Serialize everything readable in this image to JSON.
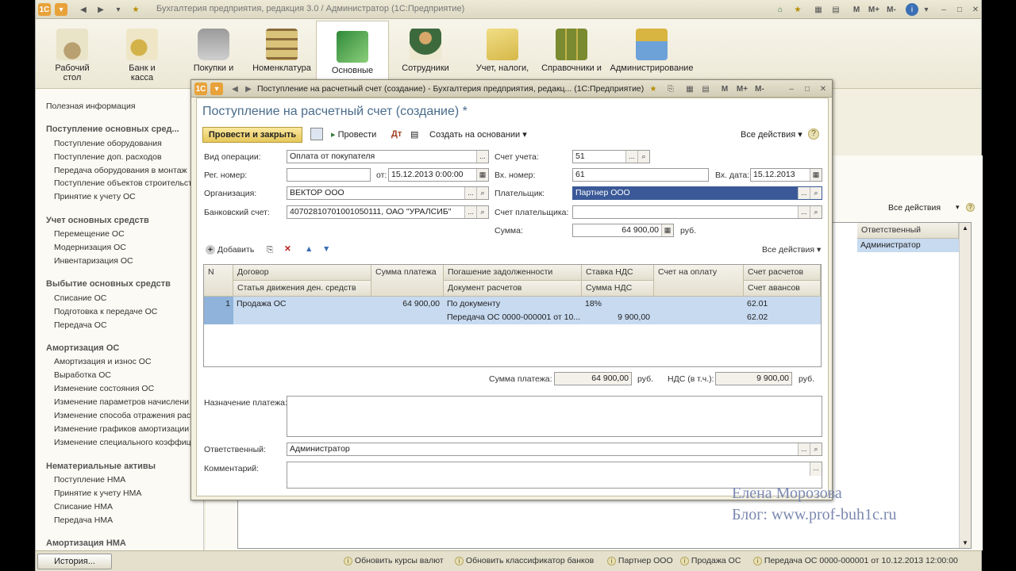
{
  "app": {
    "title": "Бухгалтерия предприятия, редакция 3.0 / Администратор  (1С:Предприятие)"
  },
  "sections": [
    {
      "label1": "Рабочий",
      "label2": "стол"
    },
    {
      "label1": "Банк и",
      "label2": "касса"
    },
    {
      "label1": "Покупки и",
      "label2": ""
    },
    {
      "label1": "Номенклатура",
      "label2": ""
    },
    {
      "label1": "Основные",
      "label2": ""
    },
    {
      "label1": "Сотрудники",
      "label2": ""
    },
    {
      "label1": "Учет, налоги,",
      "label2": ""
    },
    {
      "label1": "Справочники и",
      "label2": ""
    },
    {
      "label1": "Администрирование",
      "label2": ""
    }
  ],
  "left_panel": {
    "useful": "Полезная информация",
    "groups": [
      {
        "title": "Поступление основных сред...",
        "items": [
          "Поступление оборудования",
          "Поступление доп. расходов",
          "Передача оборудования в монтаж",
          "Поступление объектов строительст",
          "Принятие к учету ОС"
        ]
      },
      {
        "title": "Учет основных средств",
        "items": [
          "Перемещение ОС",
          "Модернизация ОС",
          "Инвентаризация ОС"
        ]
      },
      {
        "title": "Выбытие основных средств",
        "items": [
          "Списание ОС",
          "Подготовка к передаче ОС",
          "Передача ОС"
        ]
      },
      {
        "title": "Амортизация ОС",
        "items": [
          "Амортизация и износ ОС",
          "Выработка ОС",
          "Изменение состояния ОС",
          "Изменение параметров начислени",
          "Изменение способа отражения рас",
          "Изменение графиков амортизации",
          "Изменение специального коэффиц"
        ]
      },
      {
        "title": "Нематериальные активы",
        "items": [
          "Поступление НМА",
          "Принятие к учету НМА",
          "Списание НМА",
          "Передача НМА"
        ]
      },
      {
        "title": "Амортизация НМА",
        "items": []
      }
    ]
  },
  "background_list": {
    "all_actions": "Все действия",
    "col_responsible": "Ответственный",
    "row_responsible": "Администратор"
  },
  "modal": {
    "window_title": "Поступление на расчетный счет (создание) - Бухгалтерия предприятия, редакц... (1С:Предприятие)",
    "header": "Поступление на расчетный счет (создание) *",
    "toolbar": {
      "post_close": "Провести и закрыть",
      "post": "Провести",
      "create_based": "Создать на основании",
      "all_actions": "Все действия"
    },
    "fields": {
      "op_type_label": "Вид операции:",
      "op_type": "Оплата от покупателя",
      "reg_label": "Рег. номер:",
      "reg": "",
      "from_label": "от:",
      "from_date": "15.12.2013  0:00:00",
      "org_label": "Организация:",
      "org": "ВЕКТОР ООО",
      "bank_label": "Банковский счет:",
      "bank": "40702810701001050111, ОАО \"УРАЛСИБ\"",
      "acc_label": "Счет учета:",
      "acc": "51",
      "in_no_label": "Вх. номер:",
      "in_no": "61",
      "in_date_label": "Вх. дата:",
      "in_date": "15.12.2013",
      "payer_label": "Плательщик:",
      "payer": "Партнер ООО",
      "payer_acc_label": "Счет плательщика:",
      "payer_acc": "",
      "sum_label": "Сумма:",
      "sum": "64 900,00",
      "sum_cur": "руб."
    },
    "grid_toolbar": {
      "add": "Добавить",
      "all_actions": "Все действия"
    },
    "grid": {
      "h1": [
        "N",
        "Договор",
        "Сумма платежа",
        "Погашение задолженности",
        "Ставка НДС",
        "Счет на оплату",
        "Счет расчетов"
      ],
      "h2": [
        "Статья движения ден. средств",
        "Документ расчетов",
        "Сумма НДС",
        "Счет авансов"
      ],
      "row1": [
        "1",
        "Продажа ОС",
        "64 900,00",
        "По документу",
        "18%",
        "",
        "62.01"
      ],
      "row2": [
        "Передача ОС 0000-000001 от 10....",
        "9 900,00",
        "62.02"
      ]
    },
    "totals": {
      "pay_label": "Сумма платежа:",
      "pay": "64 900,00",
      "pay_cur": "руб.",
      "vat_label": "НДС (в т.ч.):",
      "vat": "9 900,00",
      "vat_cur": "руб."
    },
    "purpose_label": "Назначение платежа:",
    "responsible_label": "Ответственный:",
    "responsible": "Администратор",
    "comment_label": "Комментарий:"
  },
  "status": {
    "history": "История...",
    "items": [
      "Обновить курсы валют",
      "Обновить классификатор банков",
      "Партнер ООО",
      "Продажа ОС",
      "Передача ОС 0000-000001 от 10.12.2013 12:00:00"
    ]
  },
  "watermark": {
    "line1": "Елена Морозова",
    "line2": "Блог: www.prof-buh1c.ru"
  },
  "colors": {
    "accent": "#3b5998",
    "header": "#4a6c8c",
    "primary_button": "#f0d36a",
    "row_select": "#c7daf0"
  }
}
